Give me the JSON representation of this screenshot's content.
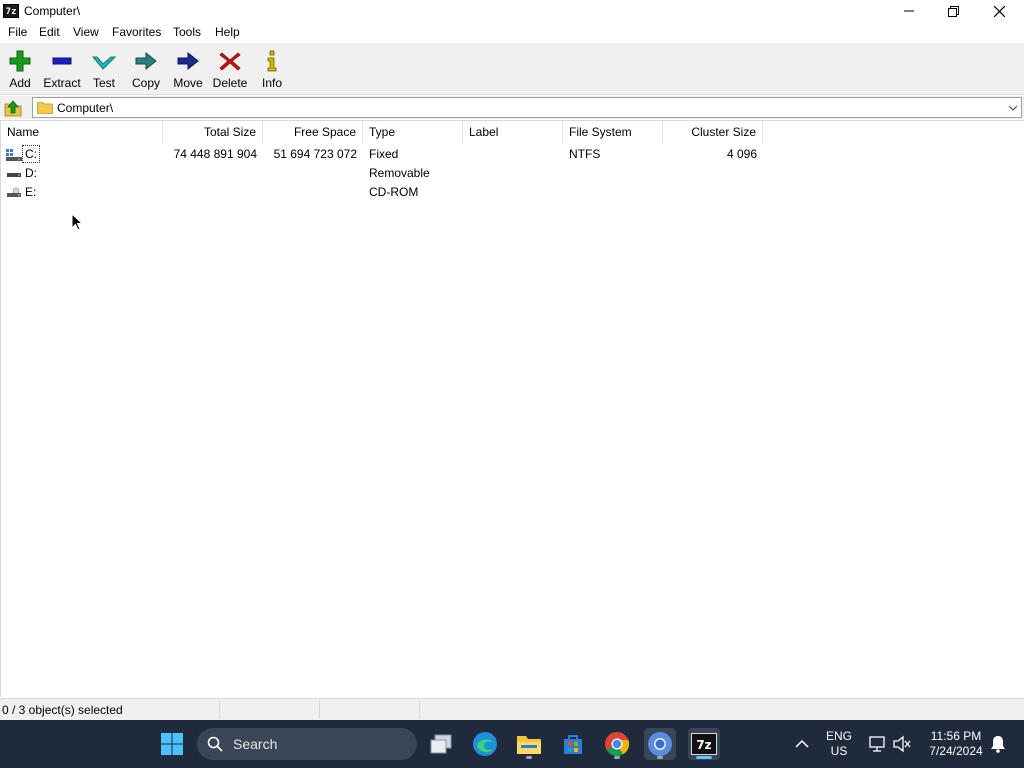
{
  "window": {
    "title": "Computer\\",
    "app_icon_label": "7z"
  },
  "menu": [
    "File",
    "Edit",
    "View",
    "Favorites",
    "Tools",
    "Help"
  ],
  "toolbar": {
    "add": "Add",
    "extract": "Extract",
    "test": "Test",
    "copy": "Copy",
    "move": "Move",
    "delete": "Delete",
    "info": "Info"
  },
  "address": {
    "path": "Computer\\"
  },
  "columns": {
    "name": "Name",
    "total_size": "Total Size",
    "free_space": "Free Space",
    "type": "Type",
    "label": "Label",
    "file_system": "File System",
    "cluster_size": "Cluster Size"
  },
  "drives": [
    {
      "name": "C:",
      "total_size": "74 448 891 904",
      "free_space": "51 694 723 072",
      "type": "Fixed",
      "label": "",
      "file_system": "NTFS",
      "cluster_size": "4 096",
      "icon": "fixed-drive-icon"
    },
    {
      "name": "D:",
      "total_size": "",
      "free_space": "",
      "type": "Removable",
      "label": "",
      "file_system": "",
      "cluster_size": "",
      "icon": "removable-drive-icon"
    },
    {
      "name": "E:",
      "total_size": "",
      "free_space": "",
      "type": "CD-ROM",
      "label": "",
      "file_system": "",
      "cluster_size": "",
      "icon": "cdrom-drive-icon"
    }
  ],
  "status": {
    "selection": "0 / 3 object(s) selected"
  },
  "taskbar": {
    "search_placeholder": "Search",
    "language": "ENG",
    "region": "US",
    "time": "11:56 PM",
    "date": "7/24/2024",
    "pinned": [
      "start-icon",
      "task-view-icon",
      "edge-icon",
      "file-explorer-icon",
      "store-icon",
      "chrome-icon",
      "chrome-profile-icon",
      "7zip-icon"
    ]
  },
  "colors": {
    "add_green": "#1a9c1a",
    "extract_blue": "#1f1fbf",
    "test_cyan": "#1fb5b5",
    "copy_teal": "#2a7f7f",
    "move_navy": "#1a2a8f",
    "delete_red": "#d01010",
    "taskbar_bg": "#1f2a3d"
  }
}
